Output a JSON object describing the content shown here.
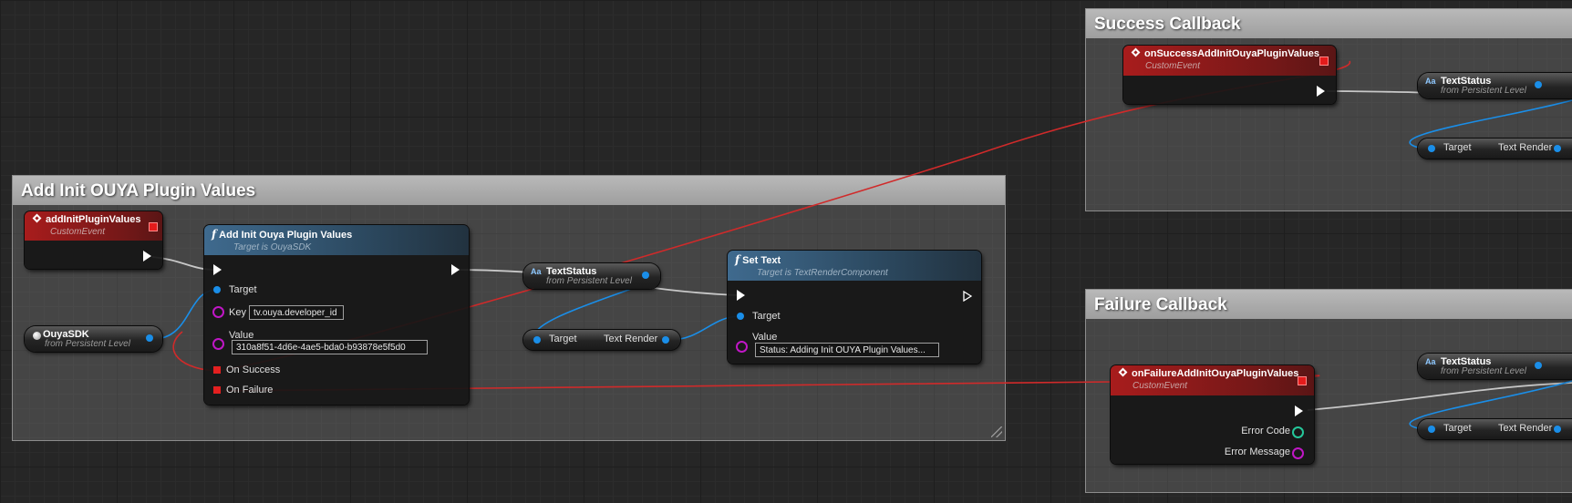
{
  "comments": {
    "add_init": "Add Init OUYA Plugin Values",
    "success": "Success Callback",
    "failure": "Failure Callback"
  },
  "nodes": {
    "add_init_event": {
      "title": "addInitPluginValues",
      "subtitle": "CustomEvent"
    },
    "ouya_sdk": {
      "title": "OuyaSDK",
      "subtitle": "from Persistent Level"
    },
    "add_init_func": {
      "title": "Add Init Ouya Plugin Values",
      "subtitle": "Target is OuyaSDK",
      "target_label": "Target",
      "key_label": "Key",
      "key_value": "tv.ouya.developer_id",
      "value_label": "Value",
      "value_value": "310a8f51-4d6e-4ae5-bda0-b93878e5f5d0",
      "on_success": "On Success",
      "on_failure": "On Failure"
    },
    "text_status": {
      "title": "TextStatus",
      "subtitle": "from Persistent Level"
    },
    "text_render_get": {
      "target": "Target",
      "output": "Text Render"
    },
    "set_text": {
      "title": "Set Text",
      "subtitle": "Target is TextRenderComponent",
      "target_label": "Target",
      "value_label": "Value",
      "value_value": "Status: Adding Init OUYA Plugin Values..."
    },
    "success_event": {
      "title": "onSuccessAddInitOuyaPluginValues",
      "subtitle": "CustomEvent"
    },
    "success_text_status": {
      "title": "TextStatus",
      "subtitle": "from Persistent Level"
    },
    "success_text_render": {
      "target": "Target",
      "output": "Text Render"
    },
    "failure_event": {
      "title": "onFailureAddInitOuyaPluginValues",
      "subtitle": "CustomEvent",
      "error_code": "Error Code",
      "error_message": "Error Message"
    },
    "failure_text_status": {
      "title": "TextStatus",
      "subtitle": "from Persistent Level"
    },
    "failure_text_render": {
      "target": "Target",
      "output": "Text Render"
    }
  },
  "colors": {
    "event_header": "#a81c1c",
    "function_header": "#3f6a8e",
    "object_pin": "#1a8ee8",
    "string_pin": "#c017c6",
    "int_pin": "#25c79a",
    "delegate_pin": "#e32020",
    "exec_wire": "#cfcfcf"
  },
  "icons": [
    "event-diamond-icon",
    "function-f-icon",
    "text-variable-icon",
    "object-ball-icon",
    "exec-arrow-icon"
  ]
}
